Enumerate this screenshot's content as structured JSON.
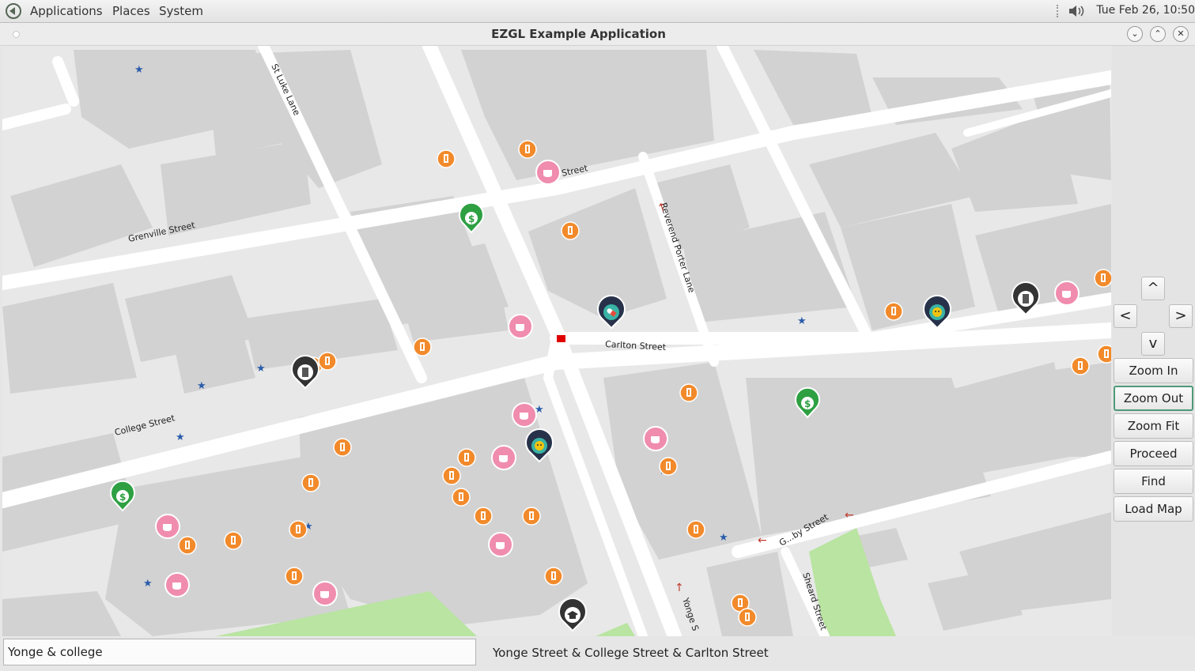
{
  "panel": {
    "menus": [
      "Applications",
      "Places",
      "System"
    ],
    "clock": "Tue Feb 26, 10:50"
  },
  "window": {
    "title": "EZGL Example Application"
  },
  "map": {
    "streets": [
      "St Luke Lane",
      "Grenville Street",
      "College Street",
      "Carlton Street",
      "Reverend Porter Lane",
      "Yonge S",
      "G...by Street",
      "Sheard Street"
    ],
    "street_fragment": "Street"
  },
  "controls": {
    "up": "^",
    "left": "<",
    "right": ">",
    "down": "v",
    "buttons": [
      "Zoom In",
      "Zoom Out",
      "Zoom Fit",
      "Proceed",
      "Find",
      "Load Map"
    ]
  },
  "search": {
    "value": "Yonge & college"
  },
  "status": {
    "text": "Yonge Street & College Street & Carlton Street"
  },
  "colors": {
    "road": "#ffffff",
    "block": "#d2d2d2",
    "park": "#b9e4a1",
    "restaurant": "#f28a2b",
    "cafe": "#f08cae",
    "bank": "#2ea042",
    "marker": "#27324a"
  }
}
